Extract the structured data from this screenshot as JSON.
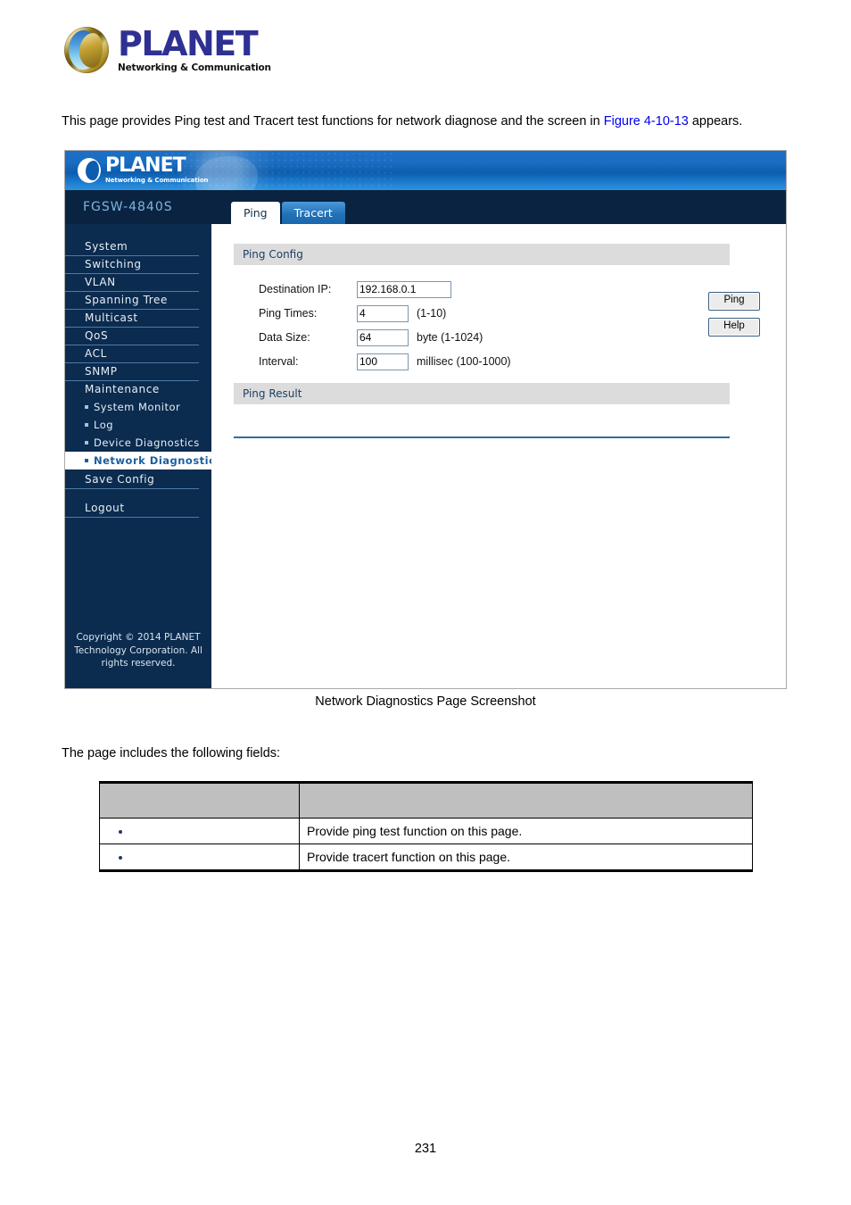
{
  "page_header": {
    "brand": "PLANET",
    "tagline": "Networking & Communication",
    "logo_icon": "planet-orb-icon"
  },
  "document": {
    "intro_before": "This page provides Ping test and Tracert test functions for network diagnose and the screen in ",
    "intro_link": "Figure 4-10-13",
    "intro_after": " appears.",
    "figure_caption": "Network Diagnostics Page Screenshot",
    "fields_intro": "The page includes the following fields:",
    "page_number": "231"
  },
  "device_ui": {
    "banner": {
      "brand": "PLANET",
      "tagline": "Networking & Communication",
      "logo_icon": "planet-orb-icon"
    },
    "model": "FGSW-4840S",
    "tabs": [
      {
        "label": "Ping",
        "active": true
      },
      {
        "label": "Tracert",
        "active": false
      }
    ],
    "sidebar": {
      "items": [
        {
          "label": "System",
          "type": "top"
        },
        {
          "label": "Switching",
          "type": "top"
        },
        {
          "label": "VLAN",
          "type": "top"
        },
        {
          "label": "Spanning Tree",
          "type": "top"
        },
        {
          "label": "Multicast",
          "type": "top"
        },
        {
          "label": "QoS",
          "type": "top"
        },
        {
          "label": "ACL",
          "type": "top"
        },
        {
          "label": "SNMP",
          "type": "top"
        },
        {
          "label": "Maintenance",
          "type": "top"
        },
        {
          "label": "System Monitor",
          "type": "sub"
        },
        {
          "label": "Log",
          "type": "sub"
        },
        {
          "label": "Device Diagnostics",
          "type": "sub"
        },
        {
          "label": "Network Diagnostics",
          "type": "sub",
          "active": true
        },
        {
          "label": "Save Config",
          "type": "top"
        },
        {
          "label": "Logout",
          "type": "top"
        }
      ],
      "copyright": "Copyright © 2014 PLANET Technology Corporation. All rights reserved."
    },
    "ping_config": {
      "title": "Ping Config",
      "rows": [
        {
          "label": "Destination IP:",
          "value": "192.168.0.1",
          "hint": ""
        },
        {
          "label": "Ping Times:",
          "value": "4",
          "hint": "(1-10)"
        },
        {
          "label": "Data Size:",
          "value": "64",
          "hint": "byte (1-1024)"
        },
        {
          "label": "Interval:",
          "value": "100",
          "hint": "millisec (100-1000)"
        }
      ],
      "buttons": [
        {
          "label": "Ping"
        },
        {
          "label": "Help"
        }
      ]
    },
    "ping_result": {
      "title": "Ping Result",
      "output": ""
    },
    "colors": {
      "sidebar_bg": "#0b2b4f",
      "header_bar": "#0a2340",
      "banner_blue": "#0d5dae",
      "active_item_text": "#1a5f9e",
      "section_head_bg": "#dcdcdc",
      "divider_blue": "#2c6ea3"
    }
  },
  "field_table": {
    "headers": [
      "",
      ""
    ],
    "rows": [
      {
        "term": "",
        "description": "Provide ping test function on this page."
      },
      {
        "term": "",
        "description": "Provide tracert function on this page."
      }
    ]
  }
}
